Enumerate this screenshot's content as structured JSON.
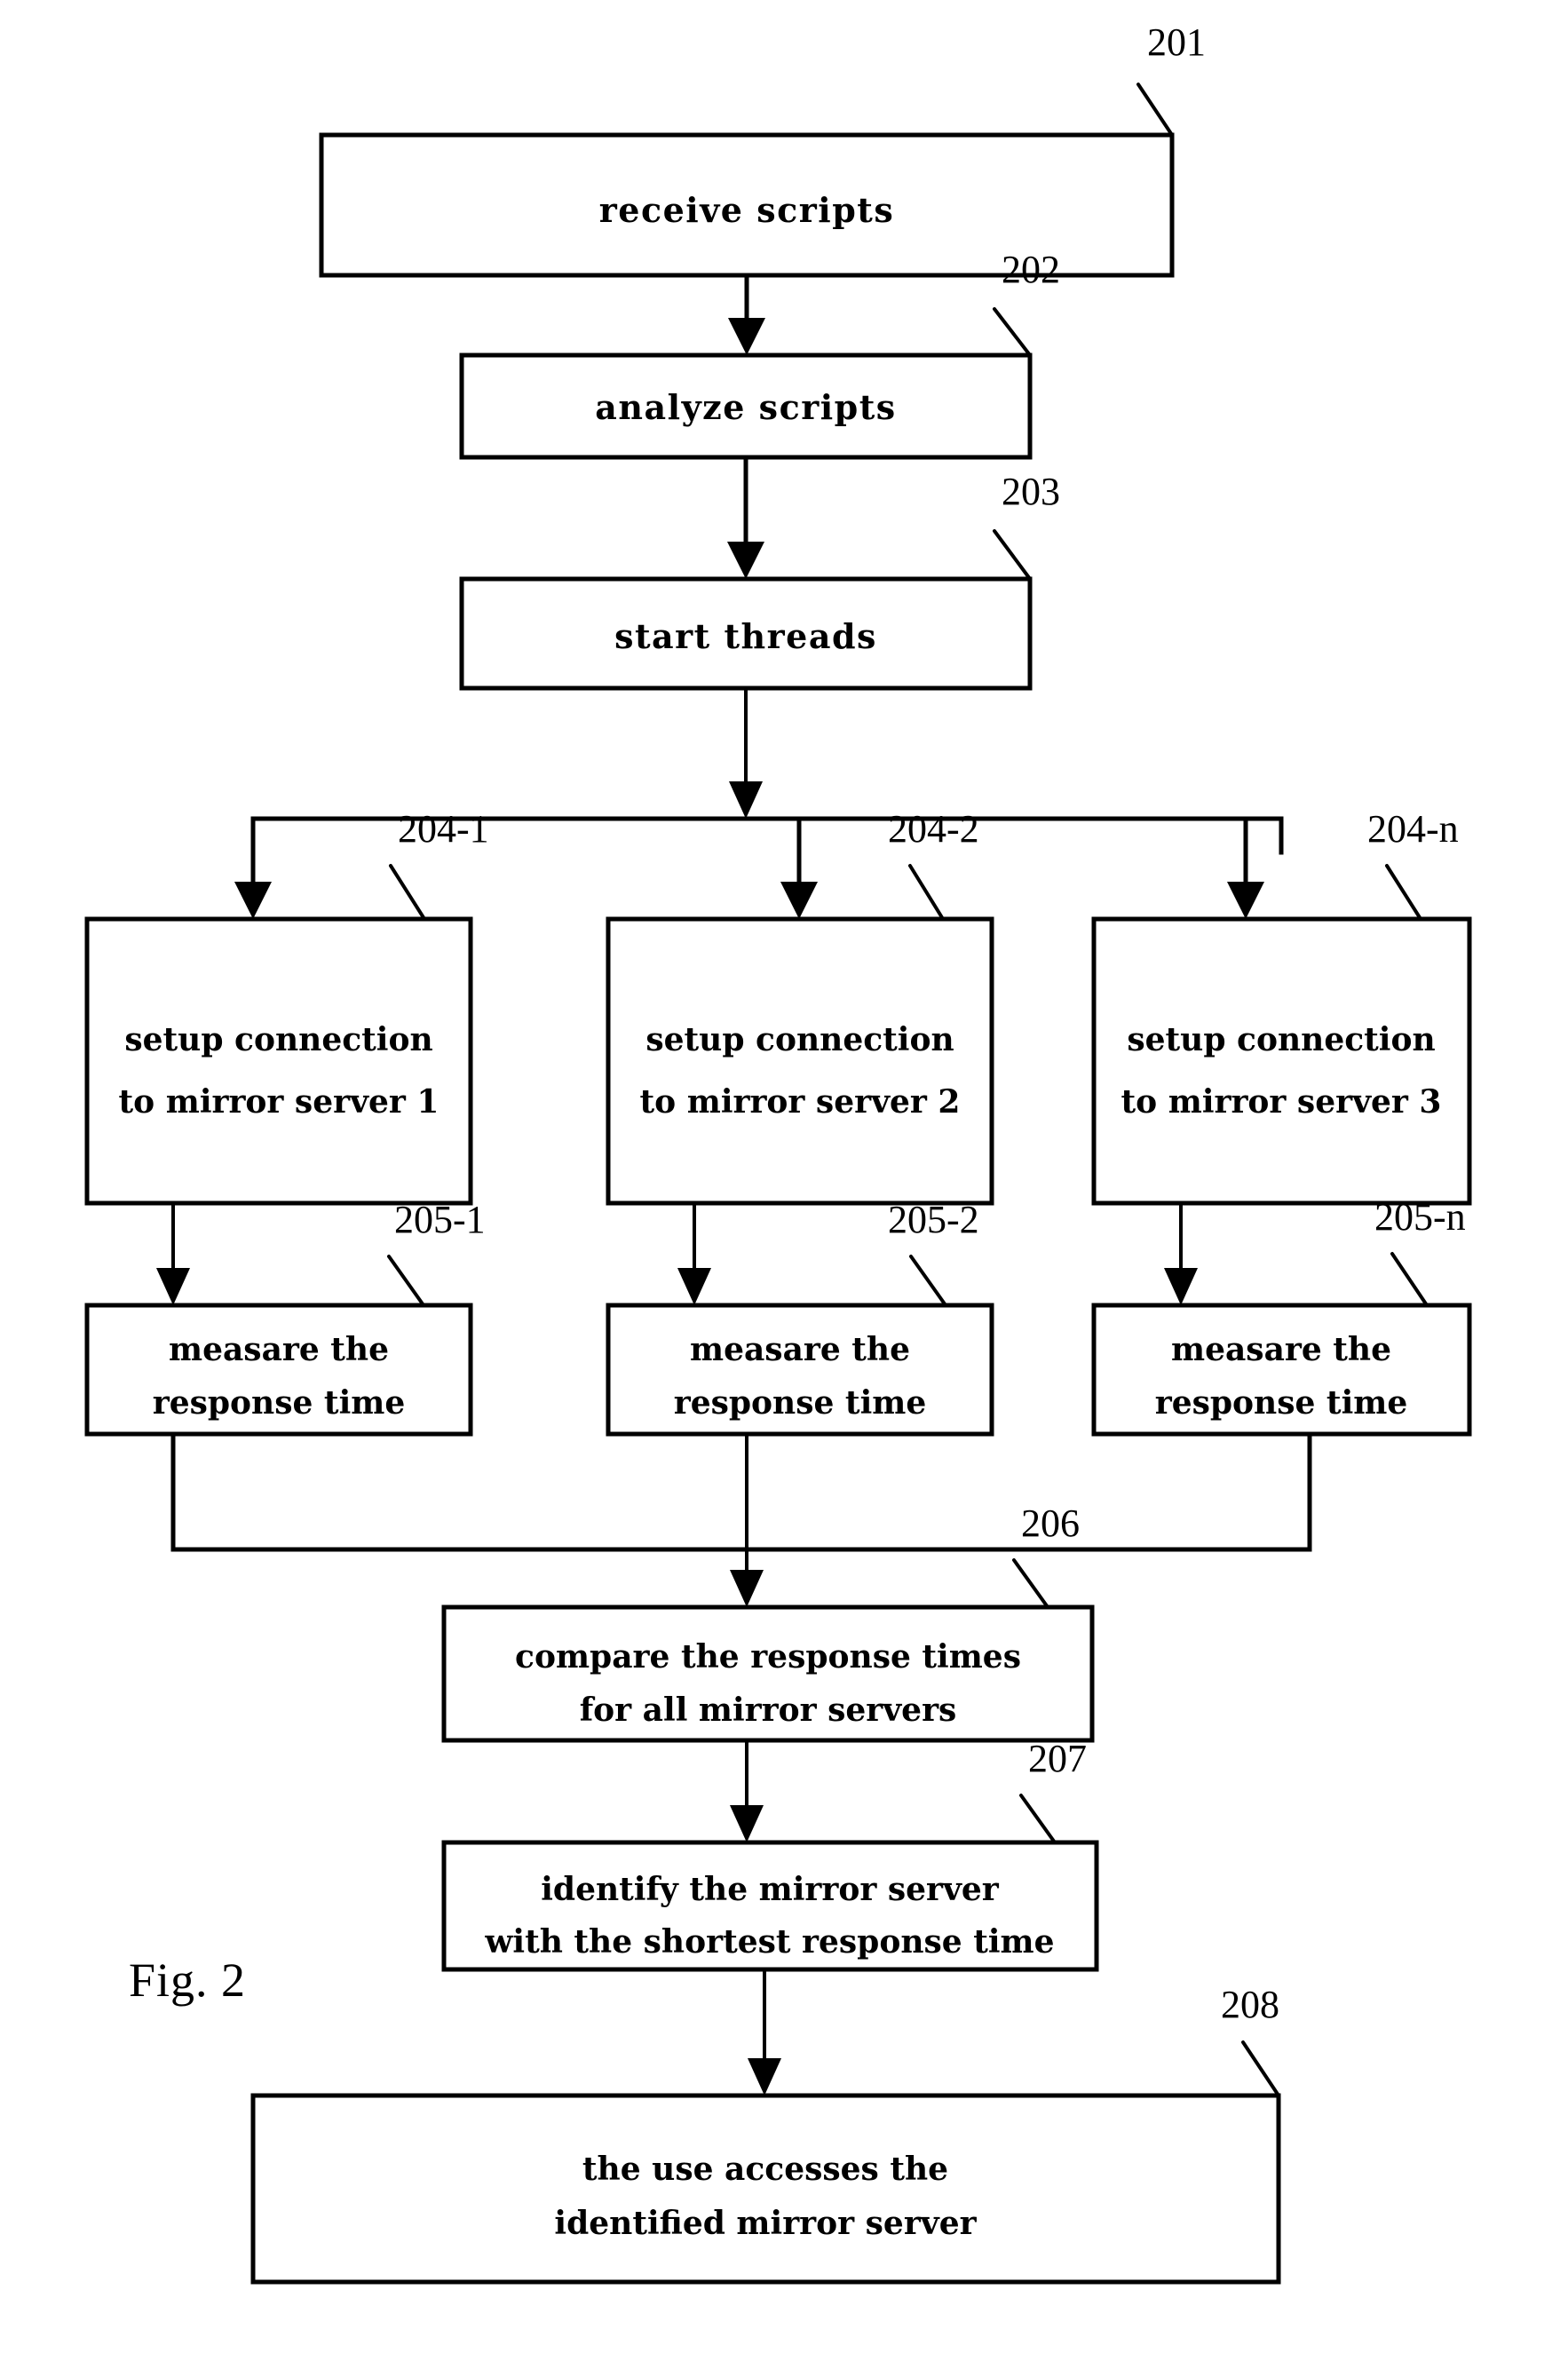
{
  "figure": {
    "caption": "Fig. 2",
    "background_color": "#ffffff",
    "line_color": "#000000"
  },
  "nodes": {
    "n201": {
      "ref": "201",
      "lines": [
        "receive scripts"
      ],
      "line1": "receive scripts"
    },
    "n202": {
      "ref": "202",
      "lines": [
        "analyze scripts"
      ],
      "line1": "analyze scripts"
    },
    "n203": {
      "ref": "203",
      "lines": [
        "start threads"
      ],
      "line1": "start threads"
    },
    "n204_1": {
      "ref": "204-1",
      "line1": "setup connection",
      "line2": "to mirror server 1"
    },
    "n204_2": {
      "ref": "204-2",
      "line1": "setup connection",
      "line2": "to mirror server 2"
    },
    "n204_n": {
      "ref": "204-n",
      "line1": "setup connection",
      "line2": "to mirror server 3"
    },
    "n205_1": {
      "ref": "205-1",
      "line1": "measare the",
      "line2": "response time"
    },
    "n205_2": {
      "ref": "205-2",
      "line1": "measare the",
      "line2": "response time"
    },
    "n205_n": {
      "ref": "205-n",
      "line1": "measare the",
      "line2": "response time"
    },
    "n206": {
      "ref": "206",
      "line1": "compare the response times",
      "line2": "for all mirror servers"
    },
    "n207": {
      "ref": "207",
      "line1": "identify the mirror server",
      "line2": "with the shortest response time"
    },
    "n208": {
      "ref": "208",
      "line1": "the use accesses the",
      "line2": "identified mirror server"
    }
  }
}
